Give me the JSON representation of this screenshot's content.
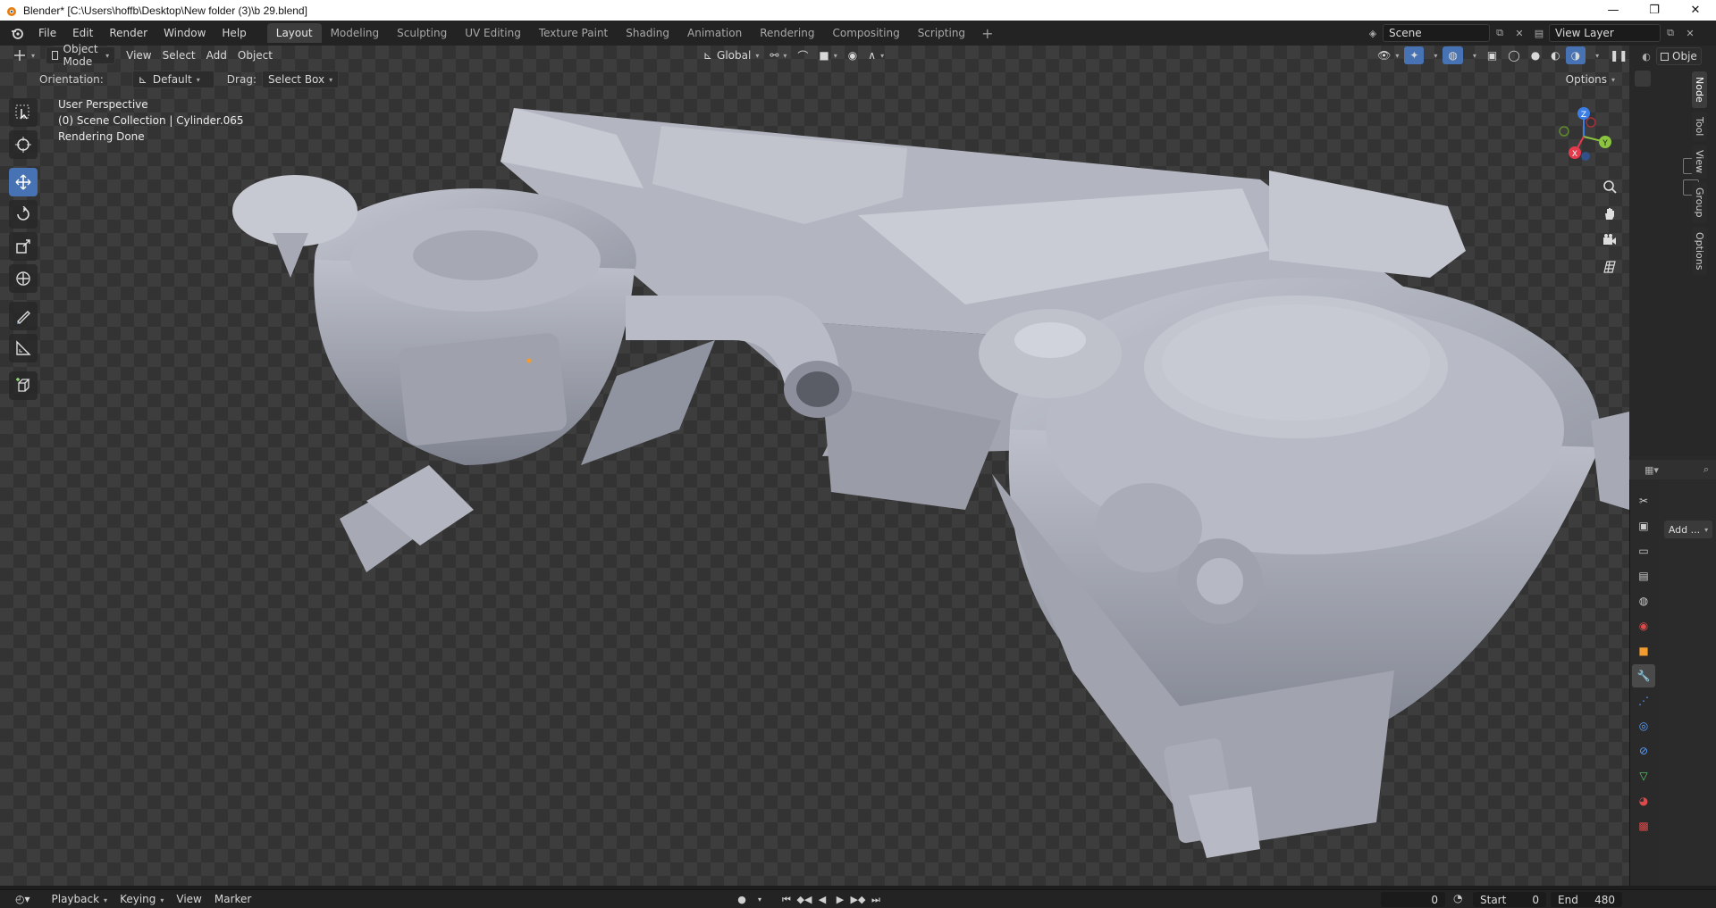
{
  "window": {
    "title": "Blender* [C:\\Users\\hoffb\\Desktop\\New folder (3)\\b 29.blend]",
    "controls": [
      "—",
      "❐",
      "✕"
    ]
  },
  "menubar": {
    "items": [
      "File",
      "Edit",
      "Render",
      "Window",
      "Help"
    ],
    "workspaces": [
      "Layout",
      "Modeling",
      "Sculpting",
      "UV Editing",
      "Texture Paint",
      "Shading",
      "Animation",
      "Rendering",
      "Compositing",
      "Scripting"
    ],
    "active_workspace": "Layout",
    "add_tab": "+",
    "scene": "Scene",
    "view_layer": "View Layer",
    "right_cut": "Obje"
  },
  "viewport_header": {
    "mode": "Object Mode",
    "menus": [
      "View",
      "Select",
      "Add",
      "Object"
    ],
    "transform_orientation": "Global",
    "options": "Options"
  },
  "tool_settings": {
    "orientation_label": "Orientation:",
    "orientation_value": "Default",
    "drag_label": "Drag:",
    "drag_value": "Select Box"
  },
  "viewport": {
    "perspective": "User Perspective",
    "collection": "(0) Scene Collection | Cylinder.065",
    "status": "Rendering Done"
  },
  "gizmo": {
    "z": "Z",
    "y": "Y",
    "x": "X"
  },
  "n_panel_tabs": [
    "Node",
    "Tool",
    "View",
    "Group",
    "Options"
  ],
  "properties": {
    "add_modifier": "Add ..."
  },
  "timeline": {
    "menus": [
      "Playback",
      "Keying",
      "View",
      "Marker"
    ],
    "current_frame": "0",
    "start_label": "Start",
    "start_value": "0",
    "end_label": "End",
    "end_value": "480"
  },
  "colors": {
    "accent": "#4772b3",
    "x_axis": "#e53a4b",
    "y_axis": "#8bc53f",
    "z_axis": "#3b7ee6"
  }
}
